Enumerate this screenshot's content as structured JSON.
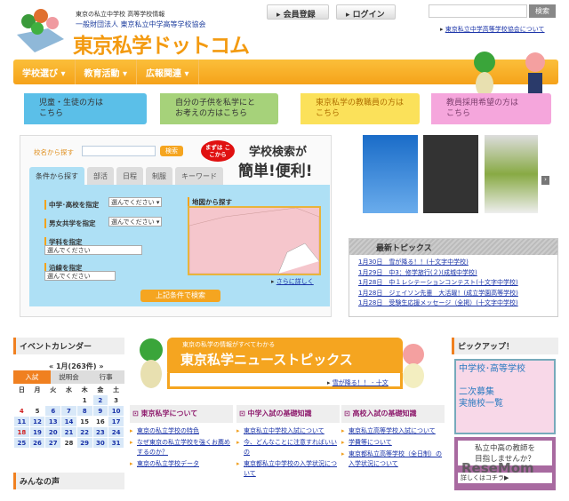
{
  "header": {
    "tagline1": "東京の私立中学校 高等学校情報",
    "tagline2": "一般財団法人 東京私立中学高等学校協会",
    "logo": "東京私学ドットコム",
    "register": "会員登録",
    "login": "ログイン",
    "search_button": "検索",
    "search_value": "",
    "assoc_link": "東京私立中学高等学校協会について"
  },
  "nav": [
    "学校選び ▾",
    "教育活動 ▾",
    "広報関連 ▾"
  ],
  "audience": [
    {
      "line1": "児童・生徒の方は",
      "line2": "こちら",
      "color": "#5bbfe8"
    },
    {
      "line1": "自分の子供を私学にと",
      "line2": "お考えの方はこちら",
      "color": "#a6d27a"
    },
    {
      "line1": "東京私学の教職員の方は",
      "line2": "こちら",
      "color": "#fbe15a"
    },
    {
      "line1": "教員採用希望の方は",
      "line2": "こちら",
      "color": "#f5a6dc"
    }
  ],
  "search": {
    "name_label": "校名から探す",
    "name_value": "",
    "name_button": "検索",
    "badge": "まずは ここから",
    "promo1": "学校検索が",
    "promo2": "簡単!便利!",
    "tabs": [
      "条件から探す",
      "部活",
      "日程",
      "制服",
      "キーワード"
    ],
    "filters": [
      {
        "label": "中学･高校を指定",
        "value": "選んでください"
      },
      {
        "label": "男女共学を指定",
        "value": "選んでください"
      },
      {
        "label": "学科を指定",
        "value": "選んでください"
      },
      {
        "label": "沿線を指定",
        "value": "選んでください"
      }
    ],
    "map_label": "地図から探す",
    "more": "さらに詳しく",
    "submit": "上記条件で検索"
  },
  "topics": {
    "title": "最新トピックス",
    "items": [
      "1月30日　雪が降る！！(十文字中学校)",
      "1月29日　中3：修学旅行(２)(成城中学校)",
      "1月28日　中１レシテーションコンテスト(十文字中学校)",
      "1月28日　ジェイソン先輩　大活躍！(成立学園高等学校)",
      "1月28日　受験生応援メッセージ（全掲）(十文字中学校)"
    ]
  },
  "calendar": {
    "title": "イベントカレンダー",
    "month": "1月(263件)",
    "tabs": [
      "入試",
      "説明会",
      "行事"
    ],
    "weekdays": [
      "日",
      "月",
      "火",
      "水",
      "木",
      "金",
      "土"
    ],
    "weeks": [
      [
        "",
        "",
        "",
        "",
        "1",
        "2",
        "3"
      ],
      [
        "4",
        "5",
        "6",
        "7",
        "8",
        "9",
        "10"
      ],
      [
        "11",
        "12",
        "13",
        "14",
        "15",
        "16",
        "17"
      ],
      [
        "18",
        "19",
        "20",
        "21",
        "22",
        "23",
        "24"
      ],
      [
        "25",
        "26",
        "27",
        "28",
        "29",
        "30",
        "31"
      ]
    ]
  },
  "voices": {
    "title": "みんなの声"
  },
  "news": {
    "subtitle": "東京の私学の情報がすべてわかる",
    "title": "東京私学ニューストピックス",
    "link": "雪が降る！！ - 十文"
  },
  "columns": [
    {
      "title": "東京私学について",
      "links": [
        "東京の私立学校の特色",
        "なぜ東京の私立学校を強くお薦めするのか？",
        "東京の私立学校データ"
      ]
    },
    {
      "title": "中学入試の基礎知識",
      "links": [
        "東京私立中学校入試について",
        "今、どんなことに注意すればいいの",
        "東京都私立中学校の入学状況について"
      ]
    },
    {
      "title": "高校入試の基礎知識",
      "links": [
        "東京私立高等学校入試について",
        "学費等について",
        "東京都私立高等学校（全日制）の入学状況について"
      ]
    }
  ],
  "pickup": {
    "title": "ピックアップ！",
    "card1_l1": "中学校･高等学校",
    "card1_l2": "二次募集",
    "card1_l3": "実施校一覧",
    "card2_l1": "私立中高の教師を",
    "card2_l2": "目指しませんか？",
    "card2_more": "詳しくはコチラ▶",
    "watermark": "ReseMom"
  }
}
